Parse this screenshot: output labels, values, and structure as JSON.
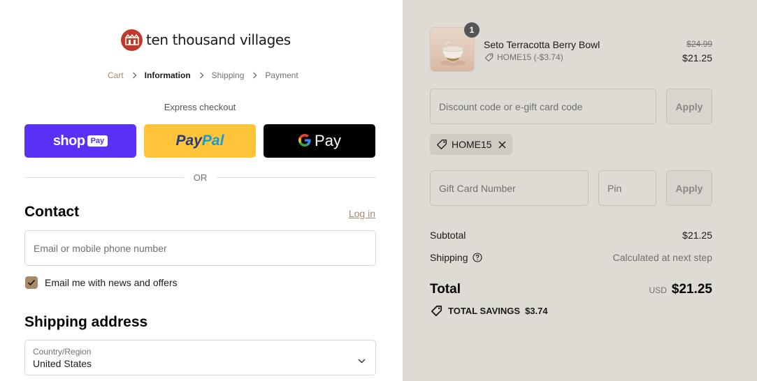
{
  "brand": {
    "name": "ten thousand villages",
    "logo_color": "#c0392b"
  },
  "breadcrumb": [
    {
      "label": "Cart",
      "state": "link"
    },
    {
      "label": "Information",
      "state": "current"
    },
    {
      "label": "Shipping",
      "state": "upcoming"
    },
    {
      "label": "Payment",
      "state": "upcoming"
    }
  ],
  "express": {
    "label": "Express checkout",
    "shop_pay": {
      "word": "shop",
      "badge": "Pay",
      "color": "#5a31f4"
    },
    "paypal": {
      "part1": "Pay",
      "part2": "Pal",
      "color": "#ffc439"
    },
    "gpay": {
      "word": "Pay",
      "color": "#000000"
    },
    "or_label": "OR"
  },
  "contact": {
    "title": "Contact",
    "login_label": "Log in",
    "email_placeholder": "Email or mobile phone number",
    "newsletter_label": "Email me with news and offers",
    "newsletter_checked": true
  },
  "shipping_address": {
    "title": "Shipping address",
    "country_label": "Country/Region",
    "country_value": "United States"
  },
  "order": {
    "item": {
      "name": "Seto Terracotta Berry Bowl",
      "quantity": "1",
      "discount_line": "HOME15 (-$3.74)",
      "original_price": "$24.99",
      "price": "$21.25"
    },
    "discount_placeholder": "Discount code or e-gift card code",
    "apply_label": "Apply",
    "applied_code": "HOME15",
    "giftcard_placeholder": "Gift Card Number",
    "pin_placeholder": "Pin",
    "summary": {
      "subtotal_label": "Subtotal",
      "subtotal_value": "$21.25",
      "shipping_label": "Shipping",
      "shipping_value": "Calculated at next step",
      "total_label": "Total",
      "currency": "USD",
      "total_value": "$21.25",
      "savings_label": "TOTAL SAVINGS",
      "savings_value": "$3.74"
    }
  },
  "colors": {
    "accent": "#a78a6c",
    "sidebar_bg": "#dedad4"
  }
}
